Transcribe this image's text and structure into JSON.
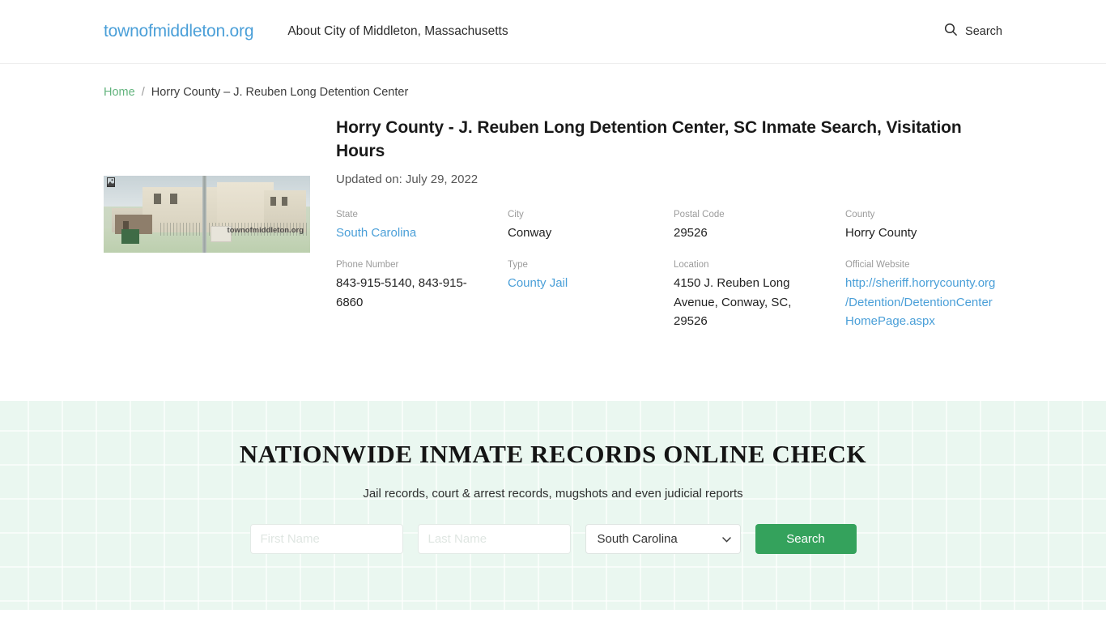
{
  "header": {
    "logo": "townofmiddleton.org",
    "nav": [
      {
        "label": "About City of Middleton, Massachusetts"
      }
    ],
    "search": {
      "label": "Search",
      "icon": "search-icon"
    }
  },
  "breadcrumb": {
    "home": "Home",
    "separator": "/",
    "current": "Horry County – J. Reuben Long Detention Center"
  },
  "article": {
    "title": "Horry County - J. Reuben Long Detention Center, SC Inmate Search, Visitation Hours",
    "updated": "Updated on: July 29, 2022",
    "photo": {
      "watermark": "townofmiddleton.org",
      "alt_icon": "broken-image-icon"
    },
    "fields": [
      {
        "label": "State",
        "value": "South Carolina",
        "is_link": true
      },
      {
        "label": "City",
        "value": "Conway",
        "is_link": false
      },
      {
        "label": "Postal Code",
        "value": "29526",
        "is_link": false
      },
      {
        "label": "County",
        "value": "Horry County",
        "is_link": false
      },
      {
        "label": "Phone Number",
        "value": "843-915-5140, 843-915-6860",
        "is_link": false
      },
      {
        "label": "Type",
        "value": "County Jail",
        "is_link": true
      },
      {
        "label": "Location",
        "value": "4150 J. Reuben Long Avenue, Conway, SC, 29526",
        "is_link": false
      },
      {
        "label": "Official Website",
        "value": "http://sheriff.horrycounty.org/Detention/DetentionCenterHomePage.aspx",
        "is_link": true
      }
    ]
  },
  "promo": {
    "title": "Nationwide Inmate Records Online Check",
    "subtitle": "Jail records, court & arrest records, mugshots and even judicial reports",
    "form": {
      "first_name_placeholder": "First Name",
      "last_name_placeholder": "Last Name",
      "state_selected": "South Carolina",
      "state_options": [
        "South Carolina"
      ],
      "submit_label": "Search"
    }
  },
  "colors": {
    "logo_blue": "#4a9fd8",
    "link_blue": "#4a9fd8",
    "breadcrumb_green": "#63b47e",
    "promo_bg": "#eaf7f0",
    "button_green": "#34a25c"
  }
}
